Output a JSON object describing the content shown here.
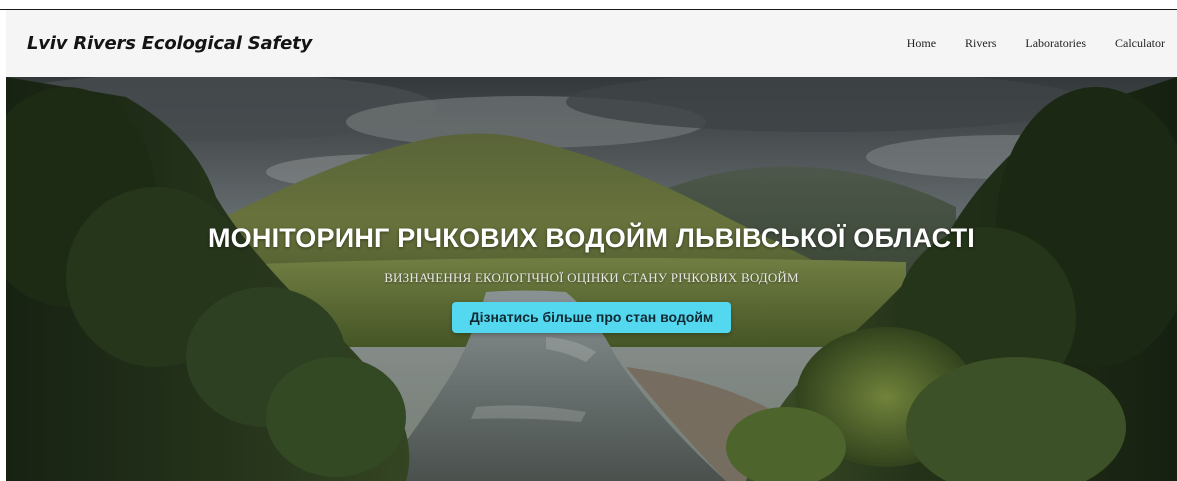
{
  "navbar": {
    "brand": "Lviv Rivers Ecological Safety",
    "links": [
      {
        "label": "Home"
      },
      {
        "label": "Rivers"
      },
      {
        "label": "Laboratories"
      },
      {
        "label": "Calculator"
      }
    ]
  },
  "hero": {
    "title": "МОНІТОРИНГ РІЧКОВИХ ВОДОЙМ ЛЬВІВСЬКОЇ ОБЛАСТІ",
    "subtitle": "ВИЗНАЧЕННЯ ЕКОЛОГІЧНОЇ ОЦІНКИ СТАНУ РІЧКОВИХ ВОДОЙМ",
    "button_label": "Дізнатись більше про стан водойм",
    "background": "river-valley-photo"
  },
  "colors": {
    "navbar_bg": "#f5f5f5",
    "accent_button": "#54d8f0",
    "hero_text": "#ffffff"
  }
}
